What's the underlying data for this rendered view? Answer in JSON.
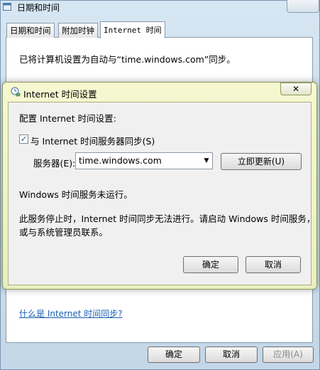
{
  "outer_window": {
    "title": "日期和时间",
    "tabs": [
      {
        "label": "日期和时间"
      },
      {
        "label": "附加时钟"
      },
      {
        "label": "Internet 时间"
      }
    ],
    "sync_info": "已将计算机设置为自动与“time.windows.com”同步。",
    "help_link": "什么是 Internet 时间同步?",
    "buttons": {
      "ok": "确定",
      "cancel": "取消",
      "apply": "应用(A)"
    }
  },
  "dialog": {
    "title": "Internet 时间设置",
    "close_glyph": "✕",
    "config_label": "配置 Internet 时间设置:",
    "sync_checkbox": {
      "label": "与 Internet 时间服务器同步(S)",
      "checked": true,
      "glyph": "✓"
    },
    "server": {
      "label": "服务器(E):",
      "value": "time.windows.com",
      "arrow_glyph": "▼"
    },
    "update_button": "立即更新(U)",
    "status": "Windows 时间服务未运行。",
    "description_lines": [
      "此服务停止时，Internet 时间同步无法进行。请启动 Windows 时间服务，",
      "或与系统管理员联系。"
    ],
    "buttons": {
      "ok": "确定",
      "cancel": "取消"
    }
  },
  "colors": {
    "dialog_bg": "#f5f8d0",
    "link": "#1a5fb4",
    "window_frame": "#c3d7e8"
  }
}
